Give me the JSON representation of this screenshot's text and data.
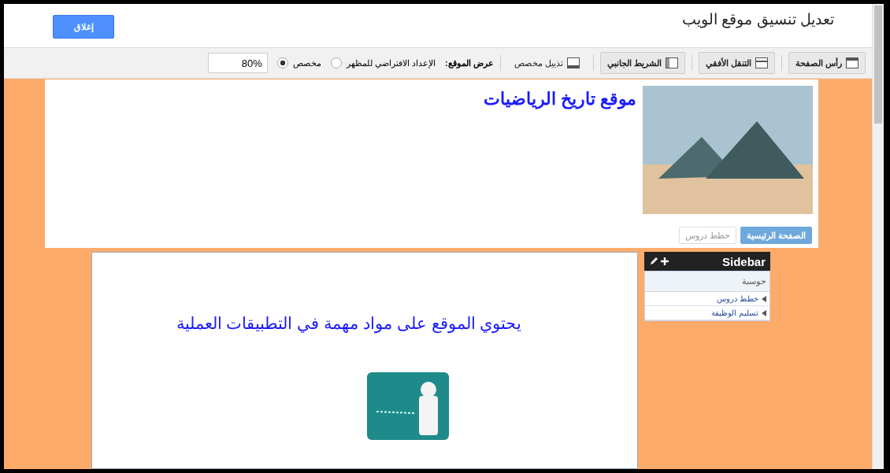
{
  "dialog": {
    "title": "تعديل تنسيق موقع الويب",
    "close_button": "إغلاق"
  },
  "toolbar": {
    "sections": [
      {
        "label": "رأس الصفحة",
        "on": true
      },
      {
        "label": "التنقل الأفقي",
        "on": true
      },
      {
        "label": "الشريط الجانبي",
        "on": true
      },
      {
        "label": "تذييل مخصص",
        "on": false
      }
    ],
    "width_label": "عرض الموقع:",
    "width_options": [
      {
        "label": "الإعداد الافتراضي للمظهر",
        "selected": false
      },
      {
        "label": "مخصص",
        "selected": true
      }
    ],
    "width_value": "80%"
  },
  "site": {
    "title": "موقع تاريخ الرياضيات",
    "nav": [
      {
        "label": "الصفحة الرئيسية",
        "selected": true
      },
      {
        "label": "خطط دروس",
        "selected": false
      }
    ],
    "content_text": "يحتوي الموقع على مواد مهمة في التطبيقات العملية",
    "sidebar": {
      "title": "Sidebar",
      "heading": "حوسبة",
      "items": [
        "خطط دروس",
        "تسليم الوظيفة"
      ]
    }
  }
}
